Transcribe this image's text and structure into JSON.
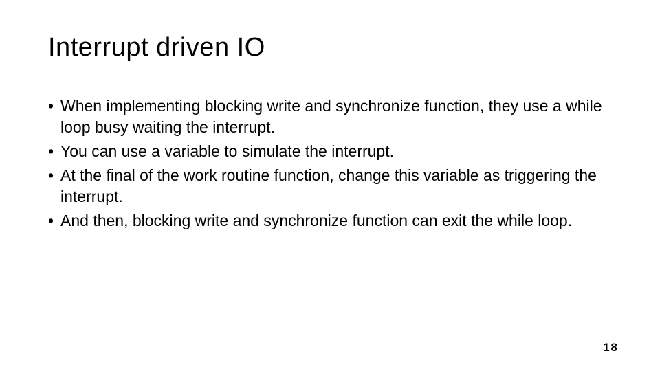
{
  "title": "Interrupt driven IO",
  "bullets": [
    "When implementing blocking write and synchronize function, they use a while loop busy waiting the interrupt.",
    "You can use a variable to simulate the interrupt.",
    "At the final of the work routine function, change this variable as triggering the interrupt.",
    "And then, blocking write and synchronize function can exit the while loop."
  ],
  "page_number": "18"
}
